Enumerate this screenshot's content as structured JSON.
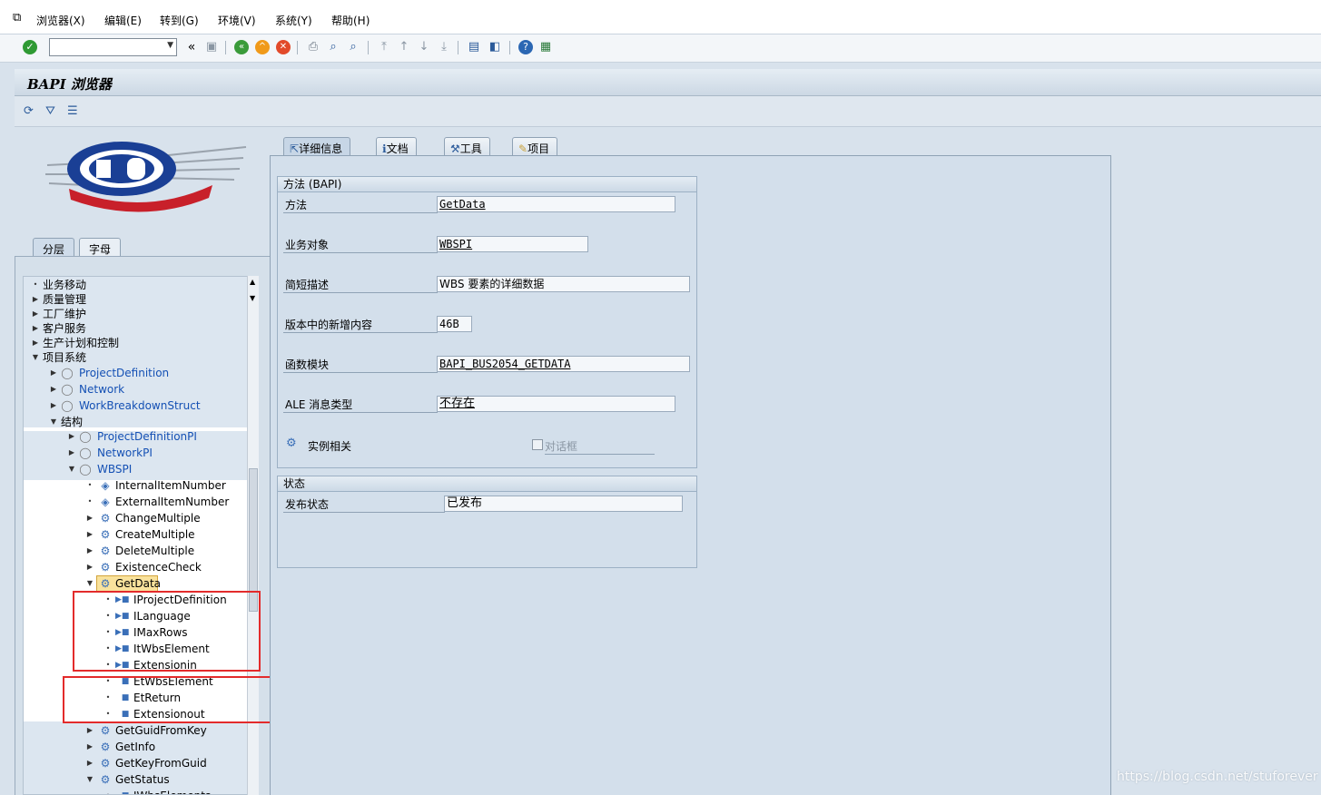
{
  "menu": [
    "浏览器(X)",
    "编辑(E)",
    "转到(G)",
    "环境(V)",
    "系统(Y)",
    "帮助(H)"
  ],
  "title": "BAPI 浏览器",
  "left_tabs": [
    "分层",
    "字母"
  ],
  "tree": [
    "业务移动",
    "质量管理",
    "工厂维护",
    "客户服务",
    "生产计划和控制",
    "项目系统",
    "ProjectDefinition",
    "Network",
    "WorkBreakdownStruct",
    "结构",
    "ProjectDefinitionPI",
    "NetworkPI",
    "WBSPI",
    "InternalItemNumber",
    "ExternalItemNumber",
    "ChangeMultiple",
    "CreateMultiple",
    "DeleteMultiple",
    "ExistenceCheck",
    "GetData",
    "IProjectDefinition",
    "ILanguage",
    "IMaxRows",
    "ItWbsElement",
    "Extensionin",
    "EtWbsElement",
    "EtReturn",
    "Extensionout",
    "GetGuidFromKey",
    "GetInfo",
    "GetKeyFromGuid",
    "GetStatus",
    "IWbsElements"
  ],
  "right_tabs": [
    "详细信息",
    "文档",
    "工具",
    "项目"
  ],
  "method_group": {
    "title": "方法 (BAPI)",
    "fields": [
      {
        "label": "方法",
        "value": "GetData"
      },
      {
        "label": "业务对象",
        "value": "WBSPI"
      },
      {
        "label": "简短描述",
        "value": "WBS 要素的详细数据"
      },
      {
        "label": "版本中的新增内容",
        "value": "46B"
      },
      {
        "label": "函数模块",
        "value": "BAPI_BUS2054_GETDATA"
      },
      {
        "label": "ALE 消息类型",
        "value": "不存在"
      }
    ],
    "instance_label": "实例相关",
    "dialog_label": "对话框"
  },
  "status_group": {
    "title": "状态",
    "label": "发布状态",
    "value": "已发布"
  },
  "watermark": "https://blog.csdn.net/stuforever"
}
